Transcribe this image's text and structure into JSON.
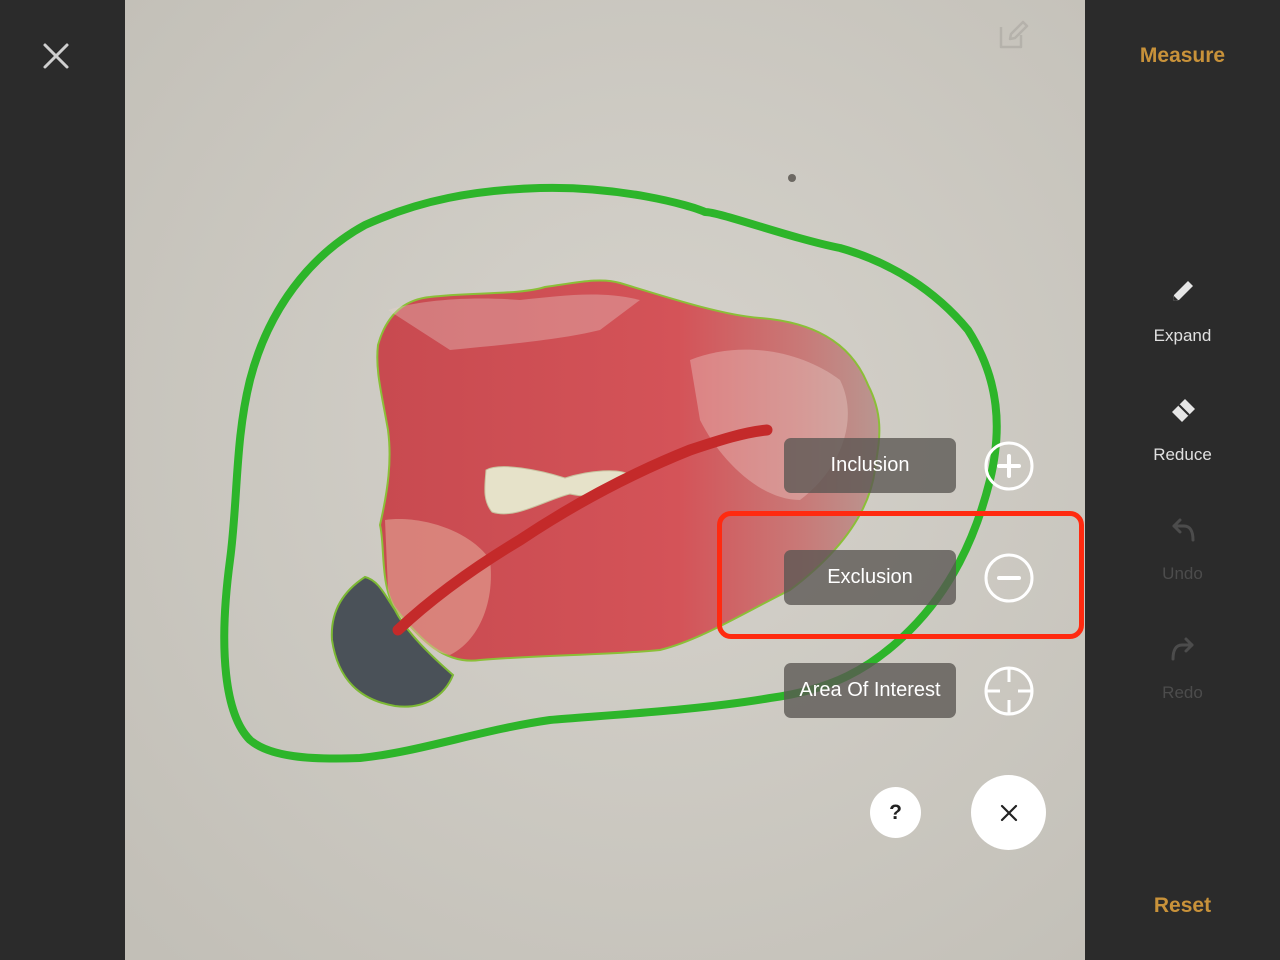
{
  "header": {
    "measure_label": "Measure"
  },
  "footer": {
    "reset_label": "Reset"
  },
  "tools": [
    {
      "label": "Expand",
      "icon": "pencil-icon",
      "state": "active"
    },
    {
      "label": "Reduce",
      "icon": "eraser-icon",
      "state": "active"
    },
    {
      "label": "Undo",
      "icon": "undo-icon",
      "state": "disabled"
    },
    {
      "label": "Redo",
      "icon": "redo-icon",
      "state": "disabled"
    }
  ],
  "modes": [
    {
      "label": "Inclusion",
      "icon": "plus-circle-icon"
    },
    {
      "label": "Exclusion",
      "icon": "minus-circle-icon"
    },
    {
      "label": "Area Of Interest",
      "icon": "crosshair-icon"
    }
  ],
  "help": {
    "label": "?"
  },
  "colors": {
    "accent": "#c8923a",
    "sidebar": "#2b2b2b",
    "highlight": "#ff2a10",
    "outline_green": "#2db52a",
    "stroke_red": "#c42a2a",
    "exclusion_dark": "#4a5158"
  }
}
